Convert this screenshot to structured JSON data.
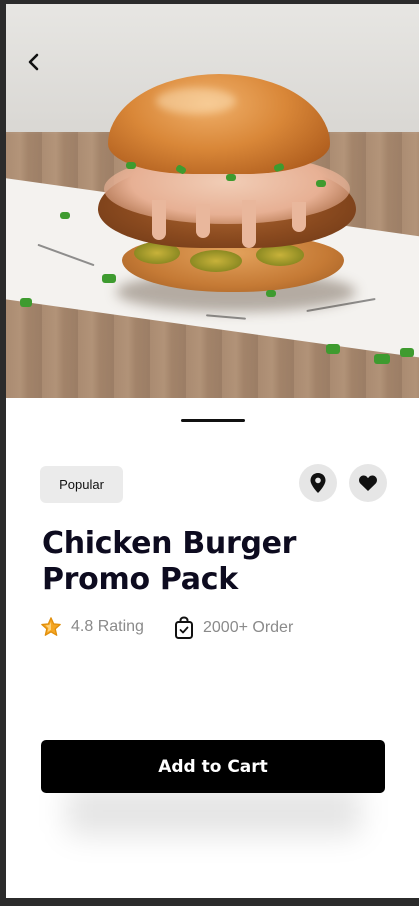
{
  "product": {
    "badge": "Popular",
    "title_line1": "Chicken Burger",
    "title_line2": "Promo Pack",
    "rating_text": "4.8 Rating",
    "orders_text": "2000+ Order"
  },
  "actions": {
    "add_to_cart_label": "Add to Cart"
  },
  "icons": {
    "back": "chevron-left-icon",
    "location": "location-pin-icon",
    "favorite": "heart-icon",
    "rating": "star-icon",
    "orders": "shopping-bag-icon"
  },
  "colors": {
    "primary_button": "#000000",
    "accent_star": "#f5a623",
    "icon_bg": "#e6e6e6",
    "badge_bg": "#ebebeb",
    "title_text": "#0d0b1f",
    "meta_text": "#8a8a8a"
  }
}
